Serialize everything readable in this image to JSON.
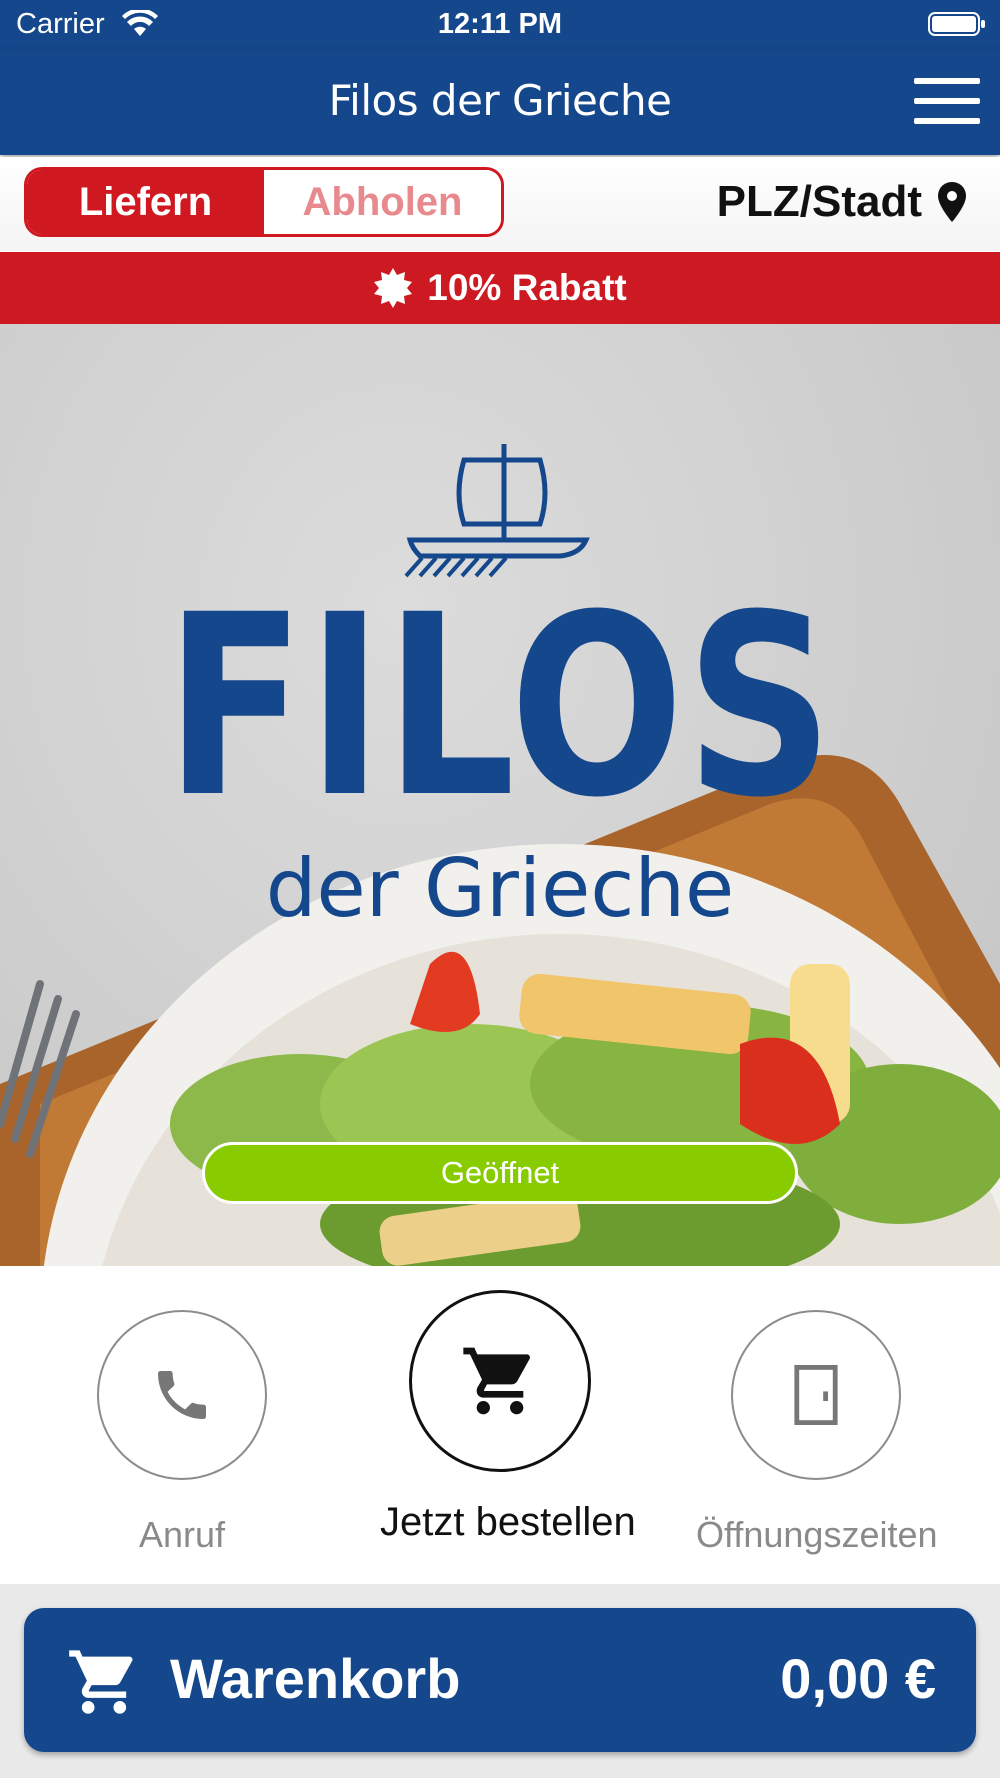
{
  "status_bar": {
    "carrier": "Carrier",
    "time": "12:11 PM"
  },
  "navbar": {
    "title": "Filos der Grieche"
  },
  "mode": {
    "deliver": "Liefern",
    "pickup": "Abholen",
    "location": "PLZ/Stadt"
  },
  "promo": {
    "text": "10% Rabatt"
  },
  "hero": {
    "logo_main": "FILOS",
    "logo_sub": "der Grieche",
    "status": "Geöffnet"
  },
  "actions": {
    "call": "Anruf",
    "order": "Jetzt bestellen",
    "hours": "Öffnungszeiten"
  },
  "cart": {
    "label": "Warenkorb",
    "total": "0,00 €"
  },
  "colors": {
    "primary": "#14478b",
    "red": "#cd1921",
    "open": "#88cc00"
  }
}
